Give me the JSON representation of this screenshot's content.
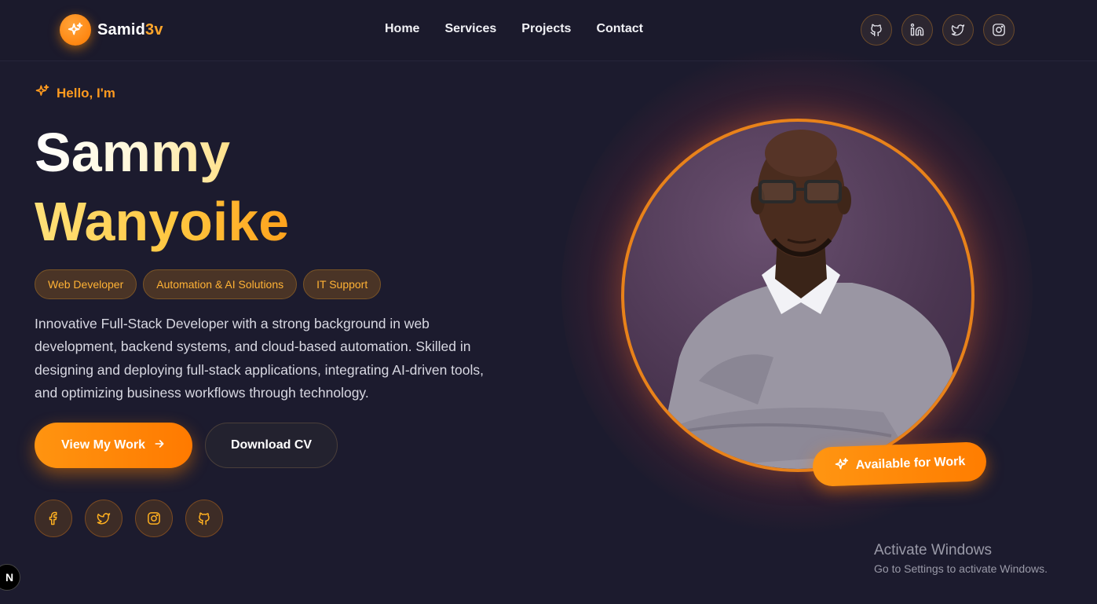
{
  "nav": {
    "brand": {
      "name_main": "Samid",
      "name_accent": "3v",
      "logo_icon": "sparkle-icon"
    },
    "links": [
      "Home",
      "Services",
      "Projects",
      "Contact"
    ],
    "socials": [
      "github-icon",
      "linkedin-icon",
      "twitter-icon",
      "instagram-icon"
    ]
  },
  "hero": {
    "greeting": "Hello, I'm",
    "first_name": "Sammy",
    "last_name": "Wanyoike",
    "tags": [
      "Web Developer",
      "Automation & AI Solutions",
      "IT Support"
    ],
    "description": "Innovative Full-Stack Developer with a strong background in web development, backend systems, and cloud-based automation. Skilled in designing and deploying full-stack applications, integrating AI-driven tools, and optimizing business workflows through technology.",
    "primary_button": "View My Work",
    "secondary_button": "Download CV",
    "socials": [
      "facebook-icon",
      "twitter-icon",
      "instagram-icon",
      "github-icon"
    ],
    "availability_badge": "Available for Work"
  },
  "watermark": {
    "title": "Activate Windows",
    "subtitle": "Go to Settings to activate Windows."
  },
  "dev_badge": "N",
  "colors": {
    "background": "#1c1b2e",
    "accent": "#ff8a00",
    "accent_light": "#ffa62b"
  }
}
